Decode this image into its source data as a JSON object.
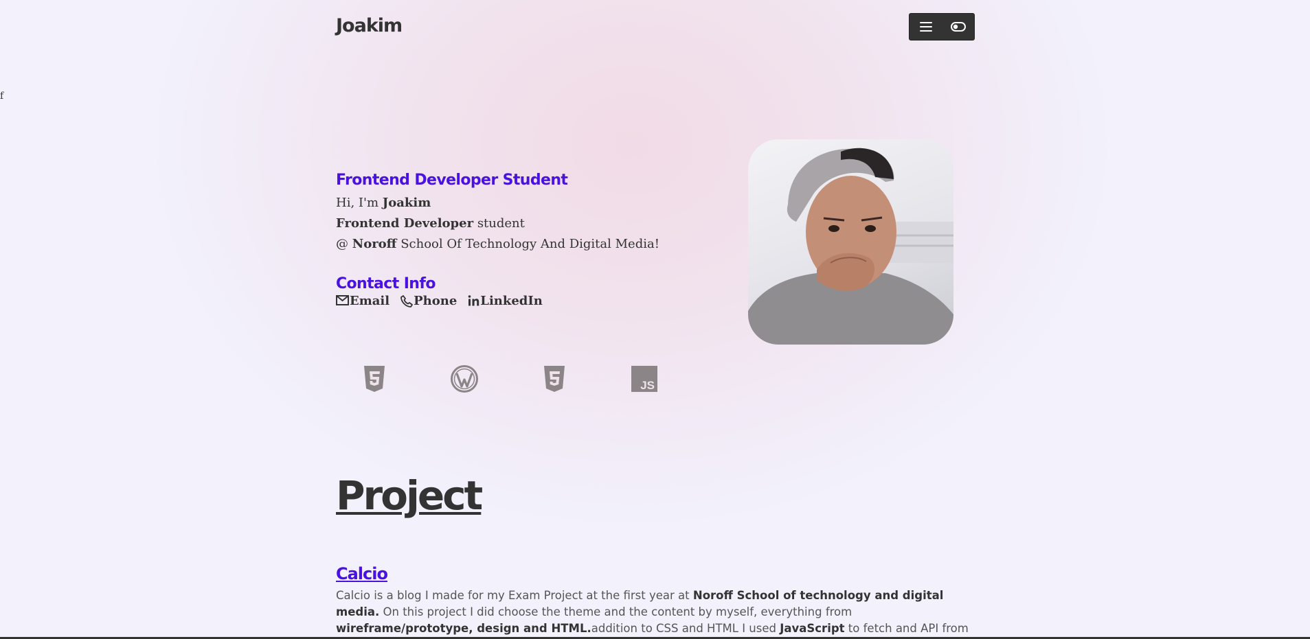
{
  "stray_text": "f",
  "header": {
    "brand": "Joakim",
    "menu_icon": "hamburger-icon",
    "theme_icon": "toggle-icon"
  },
  "hero": {
    "role_heading": "Frontend Developer Student",
    "line1_pre": "Hi, I'm ",
    "line1_bold": "Joakim",
    "line2_bold": "Frontend Developer",
    "line2_post": " student",
    "line3_pre": "@ ",
    "line3_bold": "Noroff",
    "line3_post": " School Of Technology And Digital Media!",
    "contact_heading": "Contact Info",
    "contacts": [
      {
        "label": "Email",
        "icon": "mail-icon"
      },
      {
        "label": "Phone",
        "icon": "phone-icon"
      },
      {
        "label": "LinkedIn",
        "icon": "linkedin-icon"
      }
    ]
  },
  "skills": [
    {
      "icon": "html5-icon"
    },
    {
      "icon": "wordpress-icon"
    },
    {
      "icon": "css3-icon"
    },
    {
      "icon": "javascript-icon",
      "text": "JS"
    }
  ],
  "projects": {
    "heading": "Project",
    "items": [
      {
        "title": "Calcio",
        "desc_1": "Calcio is a blog I made for my Exam Project at the first year at ",
        "desc_2_bold": "Noroff School of technology and digital media.",
        "desc_3": " On this project I did choose the theme and the content by myself, everything from ",
        "desc_4_bold": "wireframe/prototype, design and HTML.",
        "desc_5": "addition to CSS and HTML I used ",
        "desc_6_bold": "JavaScript",
        "desc_7": " to fetch and API from a"
      }
    ]
  },
  "colors": {
    "accent": "#4a12e0",
    "text": "#333333",
    "icon_gray": "#8c8588"
  }
}
